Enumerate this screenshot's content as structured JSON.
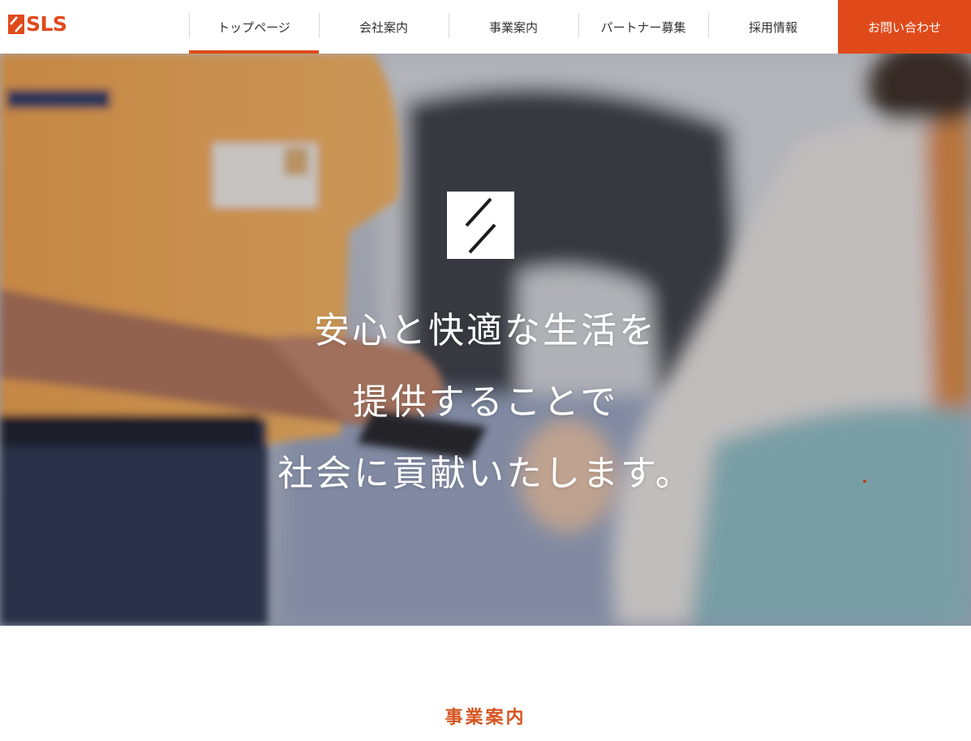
{
  "header": {
    "logo_text": "SLS",
    "nav": [
      {
        "label": "トップページ"
      },
      {
        "label": "会社案内"
      },
      {
        "label": "事業案内"
      },
      {
        "label": "パートナー募集"
      },
      {
        "label": "採用情報"
      }
    ],
    "contact_label": "お問い合わせ"
  },
  "hero": {
    "lines": [
      "安心と快適な生活を",
      "提供することで",
      "社会に貢献いたします。"
    ]
  },
  "section": {
    "title": "事業案内"
  },
  "colors": {
    "accent": "#e04a1b",
    "section_title": "#d5541f"
  }
}
